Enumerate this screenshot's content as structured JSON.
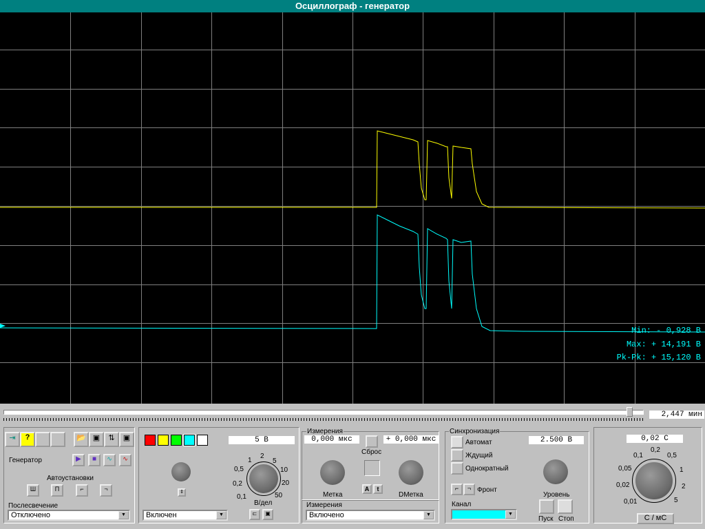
{
  "window": {
    "title": "Осциллограф - генератор"
  },
  "measurements": {
    "min": "Min: -  0,928 В",
    "max": "Max: + 14,191 В",
    "pkpk": "Pk-Pk: + 15,120 В"
  },
  "time_position": "2,447 мин",
  "left_panel": {
    "generator_label": "Генератор",
    "autoset_label": "Автоустановки",
    "persistence_label": "Послесвечение",
    "persistence_value": "Отключено"
  },
  "channel_panel": {
    "volts_value": "5  В",
    "scale_label": "В/дел",
    "scale_ticks": [
      "0,1",
      "0,2",
      "0,5",
      "1",
      "2",
      "5",
      "10",
      "20",
      "50"
    ],
    "channel_state": "Включен",
    "colors": [
      "#ff0000",
      "#ffff00",
      "#00ff00",
      "#00ffff",
      "#ffffff"
    ]
  },
  "measure_panel": {
    "title": "Измерения",
    "marker_value": "0,000 мкс",
    "dmarker_value": "+  0,000 мкс",
    "reset_label": "Сброс",
    "marker_label": "Метка",
    "dmarker_label": "DМетка",
    "measure_label": "Измерения",
    "measure_value": "Включено"
  },
  "sync_panel": {
    "title": "Синхронизация",
    "level_value": "2.500  В",
    "auto_label": "Автомат",
    "wait_label": "Ждущий",
    "single_label": "Однократный",
    "edge_label": "Фронт",
    "level_label": "Уровень",
    "channel_label": "Канал",
    "channel_color": "#00ffff",
    "start_label": "Пуск",
    "stop_label": "Стоп"
  },
  "time_panel": {
    "value": "0,02  С",
    "ticks": [
      "0,01",
      "0,02",
      "0,05",
      "0,1",
      "0,2",
      "0,5",
      "1",
      "2",
      "5"
    ],
    "units_button": "С / мС"
  }
}
